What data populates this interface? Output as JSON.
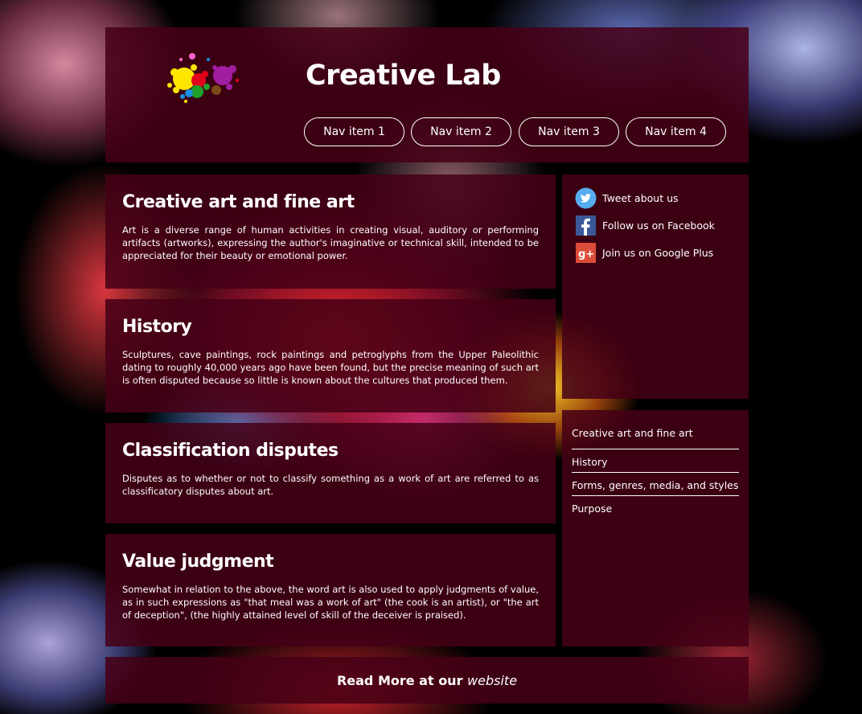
{
  "header": {
    "title": "Creative Lab",
    "nav": [
      "Nav item 1",
      "Nav item 2",
      "Nav item 3",
      "Nav item 4"
    ]
  },
  "articles": [
    {
      "title": "Creative art and fine art",
      "body": "Art is a diverse range of human activities in creating visual, auditory or performing artifacts (artworks), expressing the author's imaginative or technical skill, intended to be appreciated for their beauty or emotional power."
    },
    {
      "title": "History",
      "body": "Sculptures, cave paintings, rock paintings and petroglyphs from the Upper Paleolithic dating to roughly 40,000 years ago have been found, but the precise meaning of such art is often disputed because so little is known about the cultures that produced them."
    },
    {
      "title": "Classification disputes",
      "body": "Disputes as to whether or not to classify something as a work of art are referred to as classificatory disputes about art."
    },
    {
      "title": "Value judgment",
      "body": "Somewhat in relation to the above, the word art is also used to apply judgments of value, as in such expressions as \"that meal was a work of art\" (the cook is an artist), or \"the art of deception\", (the highly attained level of skill of the deceiver is praised)."
    }
  ],
  "social": [
    {
      "icon": "twitter-icon",
      "label": "Tweet about us",
      "color": "#55acee"
    },
    {
      "icon": "facebook-icon",
      "label": "Follow us on Facebook",
      "color": "#3b5998"
    },
    {
      "icon": "google-plus-icon",
      "label": "Join us on Google Plus",
      "color": "#dd4b39"
    }
  ],
  "toc": [
    "Creative art and fine art",
    "History",
    "Forms, genres, media, and styles",
    "Purpose"
  ],
  "footer": {
    "text": "Read More at our",
    "link": "website"
  },
  "colors": {
    "panel": "#46001a",
    "text": "#ffffff"
  }
}
